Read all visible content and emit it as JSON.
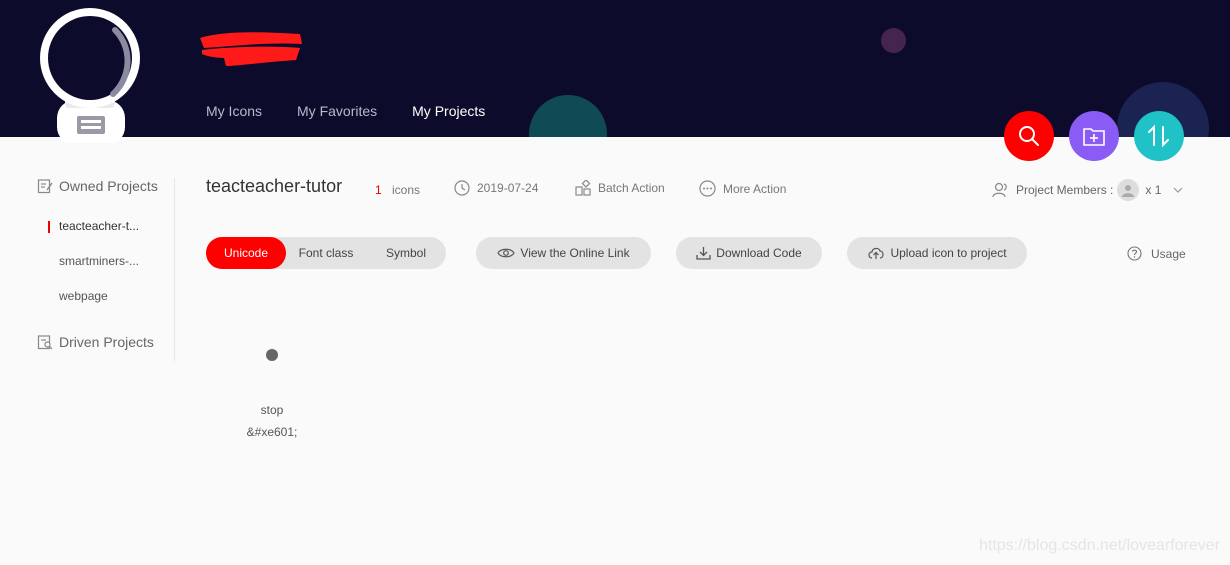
{
  "header": {
    "nav": [
      {
        "label": "My Icons",
        "active": false
      },
      {
        "label": "My Favorites",
        "active": false
      },
      {
        "label": "My Projects",
        "active": true
      }
    ]
  },
  "fabs": {
    "search_icon": "search-icon",
    "add_project_icon": "folder-add-icon",
    "sort_icon": "sort-icon"
  },
  "sidebar": {
    "owned_label": "Owned Projects",
    "projects": [
      {
        "label": "teacteacher-t...",
        "active": true
      },
      {
        "label": "smartminers-...",
        "active": false
      },
      {
        "label": "webpage",
        "active": false
      }
    ],
    "driven_label": "Driven Projects"
  },
  "project": {
    "title": "teacteacher-tutor",
    "icon_count": "1",
    "icon_unit": "icons",
    "date": "2019-07-24",
    "batch_action": "Batch Action",
    "more_action": "More Action",
    "members_label": "Project Members :",
    "members_count": "x 1"
  },
  "toolbar": {
    "segments": [
      {
        "label": "Unicode",
        "active": true
      },
      {
        "label": "Font class",
        "active": false
      },
      {
        "label": "Symbol",
        "active": false
      }
    ],
    "view_link": "View the Online Link",
    "download": "Download Code",
    "upload": "Upload icon to project",
    "usage": "Usage"
  },
  "icons": [
    {
      "name": "stop",
      "code": "&#xe601;"
    }
  ],
  "watermark": "https://blog.csdn.net/lovearforever",
  "colors": {
    "accent": "#ff0000",
    "header_bg": "#0d0b2b",
    "fab_purple": "#8a5cf5",
    "fab_teal": "#1fc2c7"
  }
}
